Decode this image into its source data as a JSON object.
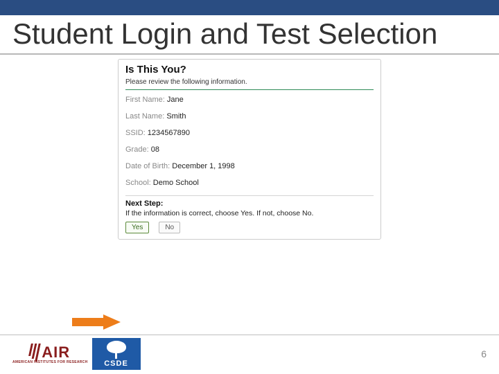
{
  "slide": {
    "title": "Student Login and Test Selection",
    "page_number": "6"
  },
  "card": {
    "heading": "Is This You?",
    "subheading": "Please review the following information.",
    "fields": {
      "first_name_label": "First Name:",
      "first_name_value": "Jane",
      "last_name_label": "Last Name:",
      "last_name_value": "Smith",
      "ssid_label": "SSID:",
      "ssid_value": "1234567890",
      "grade_label": "Grade:",
      "grade_value": "08",
      "dob_label": "Date of Birth:",
      "dob_value": "December 1, 1998",
      "school_label": "School:",
      "school_value": "Demo School"
    },
    "next_step_title": "Next Step:",
    "next_step_text": "If the information is correct, choose Yes. If not, choose No.",
    "yes_label": "Yes",
    "no_label": "No"
  },
  "footer": {
    "air_text": "AIR",
    "air_sub": "AMERICAN INSTITUTES FOR RESEARCH",
    "csde_text": "CSDE"
  }
}
